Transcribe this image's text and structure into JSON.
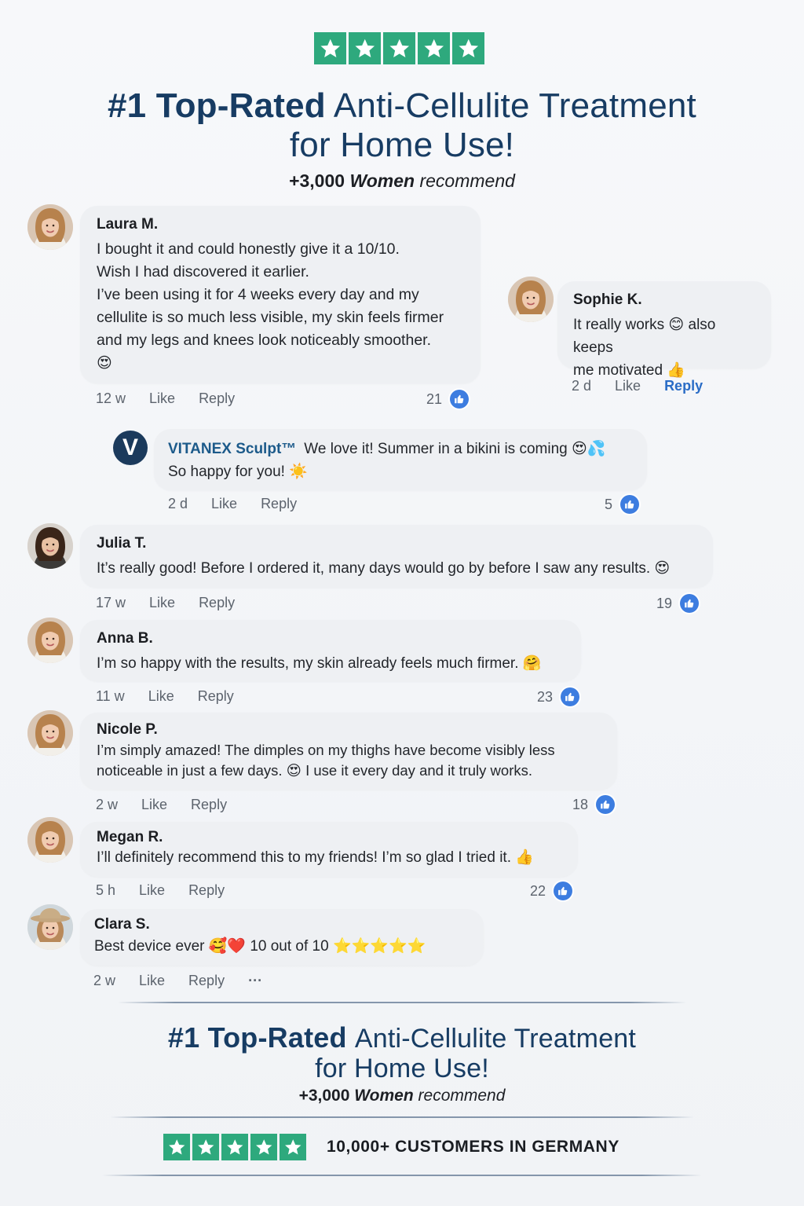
{
  "header": {
    "rating_stars": 5,
    "headline_strong": "#1 Top-Rated",
    "headline_rest": "Anti-Cellulite Treatment",
    "headline_line2": "for Home Use!",
    "tagline_number": "+3,000",
    "tagline_women": "Women",
    "tagline_rest": "recommend"
  },
  "comments": [
    {
      "author": "Laura M.",
      "lines": [
        "I bought it and could honestly give it a 10/10.",
        "Wish I had discovered it earlier.",
        "I’ve been using it for 4 weeks every day and my",
        "cellulite is so much less visible, my skin feels firmer",
        "and my legs and knees look noticeably smoother."
      ],
      "emoji": "😍",
      "time": "12 w",
      "like_label": "Like",
      "reply_label": "Reply",
      "likes": "21"
    },
    {
      "author": "Sophie K.",
      "lines": [
        "It really works 😊 also keeps",
        "me motivated 👍"
      ],
      "time": "2 d",
      "like_label": "Like",
      "reply_label": "Reply"
    },
    {
      "author": "VITANEX Sculpt™",
      "avatar_letter": "V",
      "line1": "We love it! Summer in a bikini is coming 😍💦",
      "line2": "So happy for you! ☀️",
      "time": "2 d",
      "like_label": "Like",
      "reply_label": "Reply",
      "likes": "5"
    },
    {
      "author": "Julia T.",
      "text": "It’s really good! Before I ordered it, many days would go by before I saw any results. 😍",
      "time": "17 w",
      "like_label": "Like",
      "reply_label": "Reply",
      "likes": "19"
    },
    {
      "author": "Anna B.",
      "text": "I’m so happy with the results, my skin already feels much firmer. 🤗",
      "time": "11 w",
      "like_label": "Like",
      "reply_label": "Reply",
      "likes": "23"
    },
    {
      "author": "Nicole P.",
      "lines": [
        "I’m simply amazed! The dimples on my thighs have become visibly less",
        "noticeable in just a few days. 😍  I use it every day and it truly works."
      ],
      "time": "2 w",
      "like_label": "Like",
      "reply_label": "Reply",
      "likes": "18"
    },
    {
      "author": "Megan R.",
      "text": "I’ll definitely recommend this to my friends! I’m so glad I tried it. 👍",
      "time": "5 h",
      "like_label": "Like",
      "reply_label": "Reply",
      "likes": "22"
    },
    {
      "author": "Clara S.",
      "text": "Best device ever 🥰❤️ 10 out of 10 ⭐⭐⭐⭐⭐",
      "time": "2 w",
      "like_label": "Like",
      "reply_label": "Reply",
      "more": "···"
    }
  ],
  "footer": {
    "headline_strong": "#1 Top-Rated",
    "headline_rest": "Anti-Cellulite Treatment",
    "headline_line2": "for Home Use!",
    "tagline_number": "+3,000",
    "tagline_women": "Women",
    "tagline_rest": "recommend",
    "rating_stars": 5,
    "customers_text": "10,000+ CUSTOMERS IN GERMANY"
  },
  "colors": {
    "star_green": "#2ea97d",
    "headline_navy": "#173c63",
    "like_blue": "#3d7de0",
    "bubble_gray": "#eef0f3",
    "brand_teal": "#1c5a8a"
  }
}
